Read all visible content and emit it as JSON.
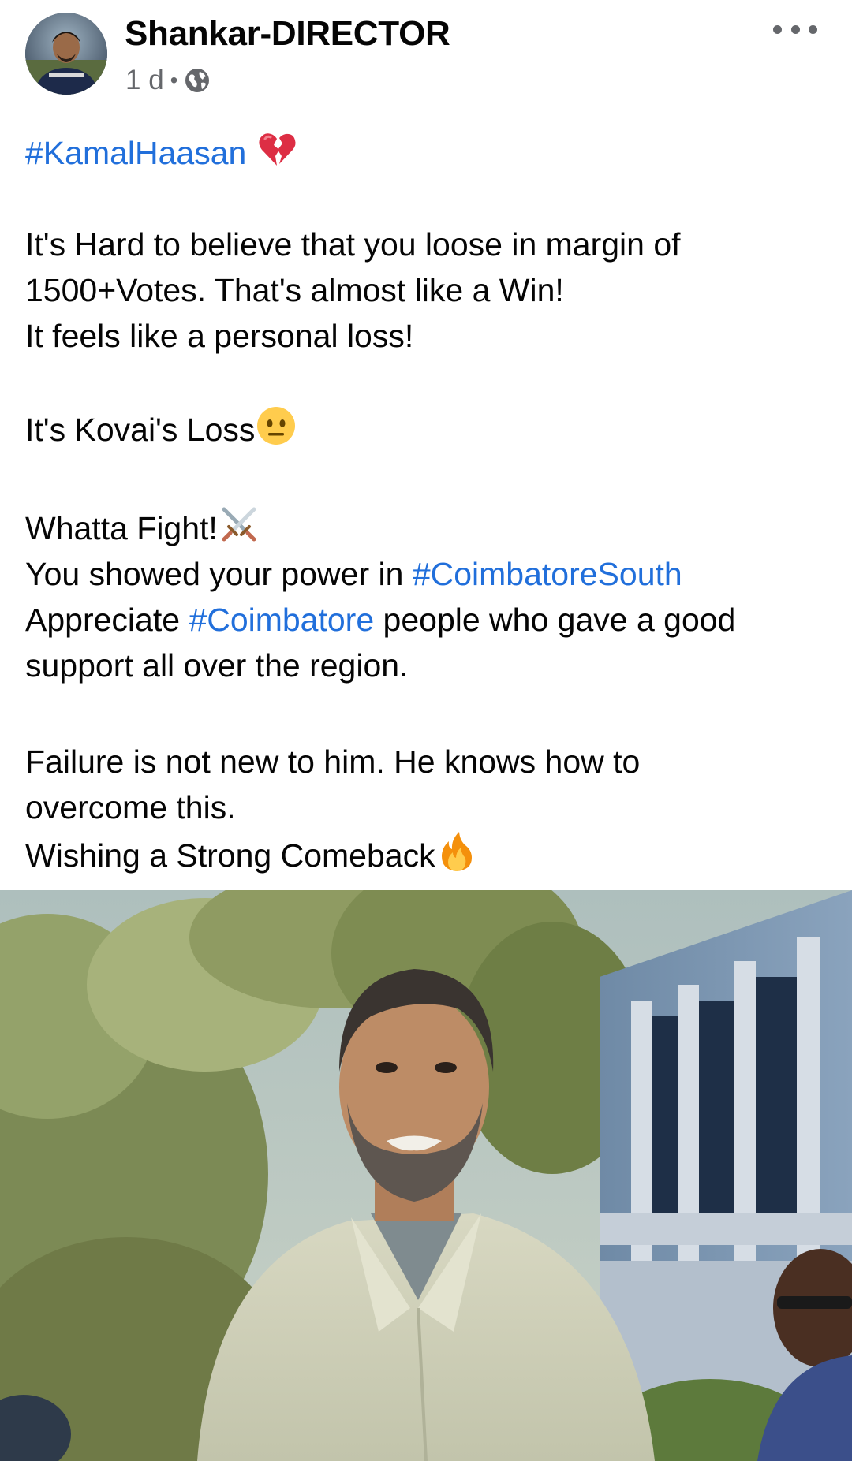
{
  "post": {
    "author_name": "Shankar-DIRECTOR",
    "timestamp": "1 d",
    "separator": "•",
    "privacy_icon": "globe-icon",
    "more_icon": "more-options-icon",
    "avatar_icon": "profile-avatar"
  },
  "body": {
    "hashtag_kamal": "#KamalHaasan",
    "emoji_broken_heart": "broken-heart-emoji",
    "line1": "It's Hard to believe that you loose in margin of",
    "line2": "1500+Votes. That's almost like a Win!",
    "line3": "It feels like a personal loss!",
    "line4": "It's Kovai's Loss",
    "emoji_neutral": "neutral-face-emoji",
    "line5": "Whatta Fight!",
    "emoji_swords": "crossed-swords-emoji",
    "line6_prefix": "You showed your power in ",
    "hashtag_south": "#CoimbatoreSouth",
    "line7_prefix": "Appreciate ",
    "hashtag_coimbatore": "#Coimbatore",
    "line7_suffix": " people who gave a good",
    "line8": "support all over the region.",
    "line9": "Failure is not new to him. He knows how to",
    "line10": "overcome this.",
    "line11": "Wishing a Strong Comeback",
    "emoji_fire": "fire-emoji"
  },
  "colors": {
    "hashtag": "#216fdb",
    "text": "#050505",
    "meta": "#65676b",
    "background": "#ffffff"
  },
  "image": {
    "subject": "post-photo"
  }
}
